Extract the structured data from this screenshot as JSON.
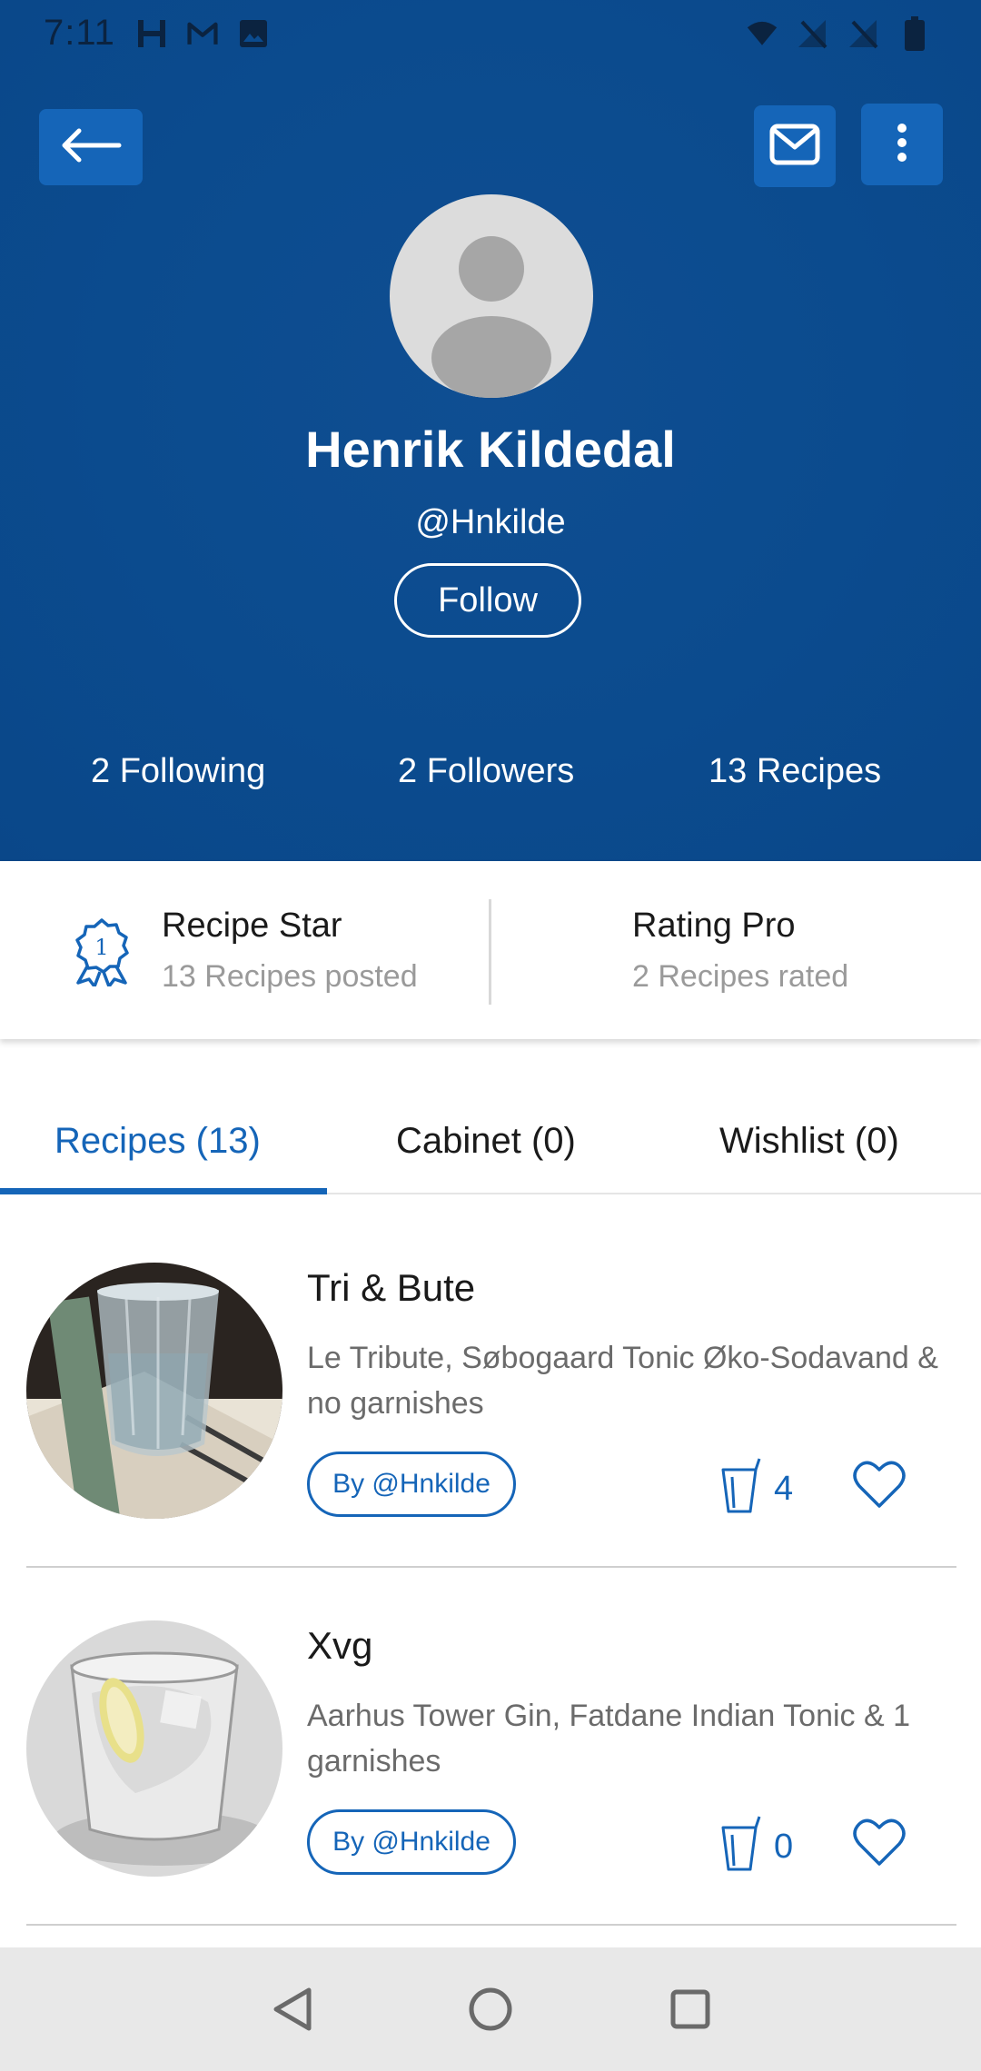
{
  "status_bar": {
    "time": "7:11",
    "left_icons": [
      "h-icon",
      "gmail-icon",
      "image-icon"
    ],
    "right_icons": [
      "wifi-icon",
      "no-signal-icon",
      "no-signal-icon",
      "battery-icon"
    ]
  },
  "toolbar": {
    "back_icon": "arrow-left-icon",
    "mail_icon": "mail-icon",
    "more_icon": "more-vertical-icon"
  },
  "profile": {
    "name": "Henrik Kildedal",
    "handle": "@Hnkilde",
    "follow_label": "Follow"
  },
  "stats": {
    "following": "2 Following",
    "followers": "2 Followers",
    "recipes": "13 Recipes"
  },
  "badges": [
    {
      "title": "Recipe Star",
      "subtitle": "13 Recipes posted",
      "icon": "award-ribbon-icon",
      "icon_number": "1"
    },
    {
      "title": "Rating Pro",
      "subtitle": "2 Recipes rated"
    }
  ],
  "tabs": [
    {
      "label": "Recipes (13)",
      "active": true
    },
    {
      "label": "Cabinet (0)",
      "active": false
    },
    {
      "label": "Wishlist (0)",
      "active": false
    }
  ],
  "recipes": [
    {
      "title": "Tri & Bute",
      "description": "Le Tribute, Søbogaard Tonic Øko-Sodavand & no garnishes",
      "author": "By @Hnkilde",
      "count": "4"
    },
    {
      "title": "Xvg",
      "description": "Aarhus Tower Gin, Fatdane Indian Tonic & 1 garnishes",
      "author": "By @Hnkilde",
      "count": "0"
    }
  ],
  "colors": {
    "header_bg": "#0b4b8e",
    "accent": "#1565b8",
    "button_bg": "#1565b8"
  },
  "nav_bar": [
    "back-triangle-icon",
    "home-circle-icon",
    "recents-square-icon"
  ]
}
